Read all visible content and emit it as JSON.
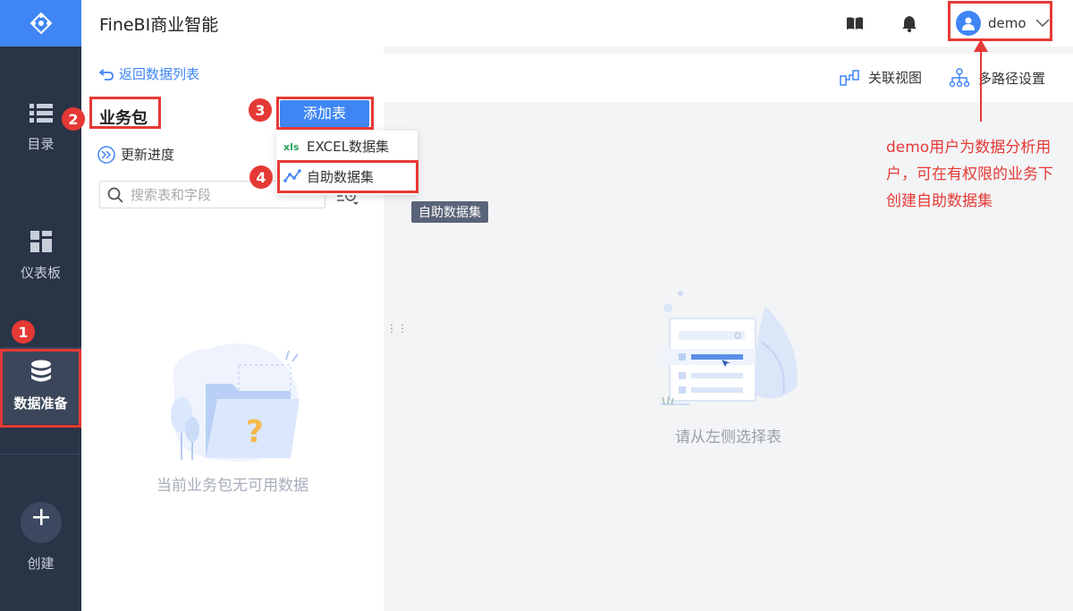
{
  "app": {
    "title": "FineBI商业智能"
  },
  "nav": {
    "items": [
      {
        "label": "目录",
        "icon": "list-icon"
      },
      {
        "label": "仪表板",
        "icon": "dashboard-icon"
      },
      {
        "label": "数据准备",
        "icon": "database-icon",
        "active": true
      },
      {
        "label": "创建",
        "icon": "plus-icon"
      }
    ]
  },
  "header": {
    "user_name": "demo"
  },
  "panel": {
    "back_label": "返回数据列表",
    "package_title": "业务包",
    "update_label": "更新进度",
    "search_placeholder": "搜索表和字段",
    "empty_text": "当前业务包无可用数据"
  },
  "add_table": {
    "button_label": "添加表",
    "menu": [
      {
        "label": "EXCEL数据集",
        "icon": "excel-icon"
      },
      {
        "label": "自助数据集",
        "icon": "self-service-dataset-icon"
      }
    ]
  },
  "main": {
    "tools": [
      {
        "label": "关联视图",
        "icon": "relation-view-icon"
      },
      {
        "label": "多路径设置",
        "icon": "multipath-icon"
      }
    ],
    "tooltip": "自助数据集",
    "empty_text": "请从左侧选择表"
  },
  "annotations": {
    "badges": [
      "1",
      "2",
      "3",
      "4"
    ],
    "note": "demo用户为数据分析用户，可在有权限的业务下创建自助数据集",
    "color": "#e53935"
  }
}
